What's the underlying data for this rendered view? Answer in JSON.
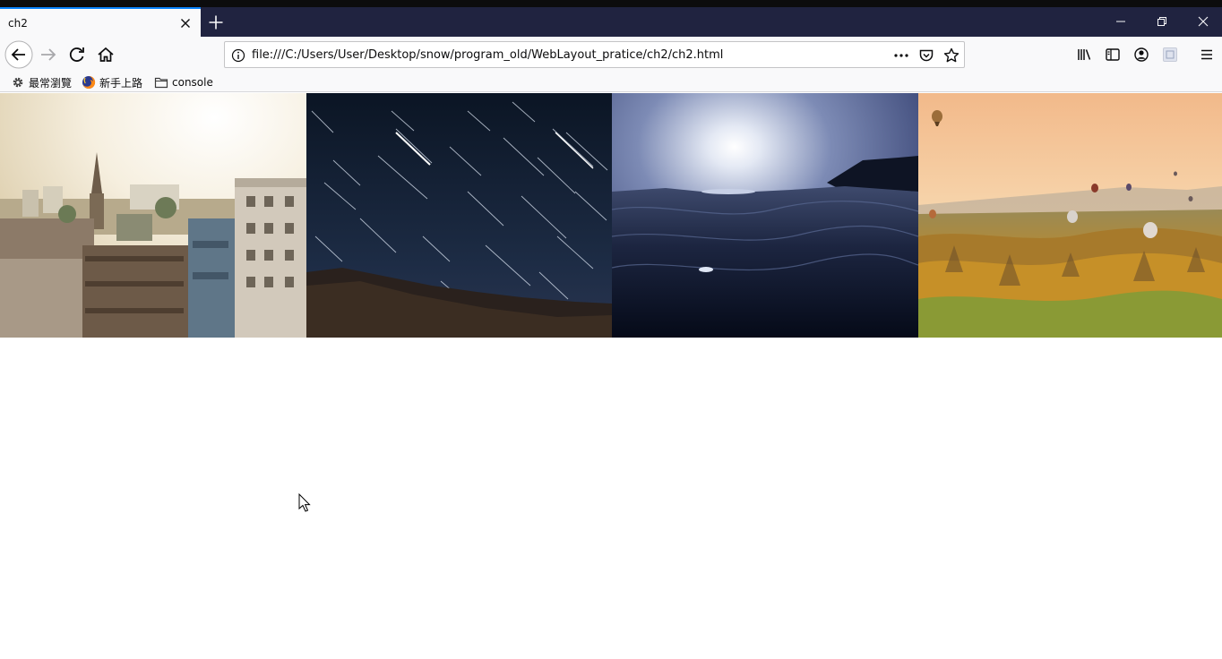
{
  "browser": {
    "tab_title": "ch2",
    "url": "file:///C:/Users/User/Desktop/snow/program_old/WebLayout_pratice/ch2/ch2.html"
  },
  "bookmarks": [
    {
      "label": "最常瀏覽",
      "icon": "gear-icon"
    },
    {
      "label": "新手上路",
      "icon": "firefox-icon"
    },
    {
      "label": "console",
      "icon": "folder-icon"
    }
  ],
  "gallery": [
    {
      "name": "city-skyline"
    },
    {
      "name": "star-trails"
    },
    {
      "name": "ocean-moon"
    },
    {
      "name": "hot-air-balloons"
    }
  ],
  "colors": {
    "tab_accent": "#0a84ff",
    "tabbar": "#202340"
  }
}
